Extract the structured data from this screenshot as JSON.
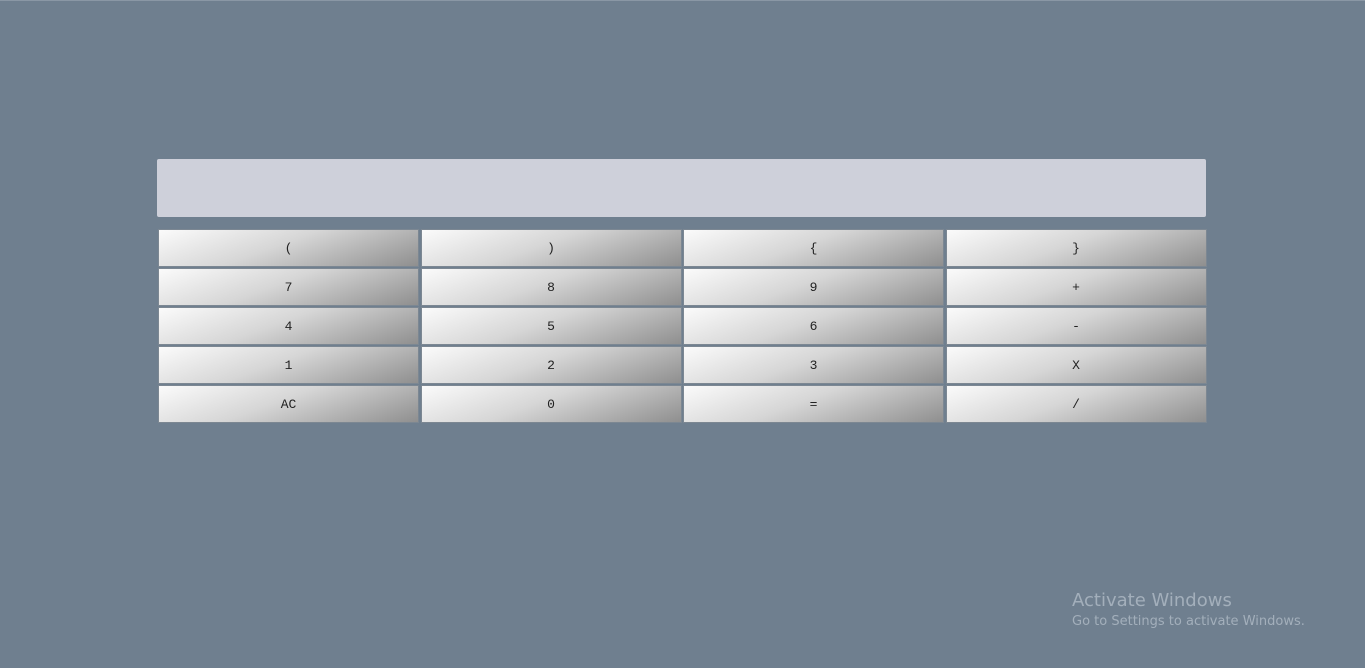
{
  "display": {
    "value": ""
  },
  "keys": [
    [
      "(",
      ")",
      "{",
      "}"
    ],
    [
      "7",
      "8",
      "9",
      "+"
    ],
    [
      "4",
      "5",
      "6",
      "-"
    ],
    [
      "1",
      "2",
      "3",
      "X"
    ],
    [
      "AC",
      "0",
      "=",
      "/"
    ]
  ],
  "watermark": {
    "title": "Activate Windows",
    "subtitle": "Go to Settings to activate Windows."
  },
  "colors": {
    "background": "#6f7f8f",
    "display": "#ced0da",
    "watermark_text": "#a3afbb"
  }
}
